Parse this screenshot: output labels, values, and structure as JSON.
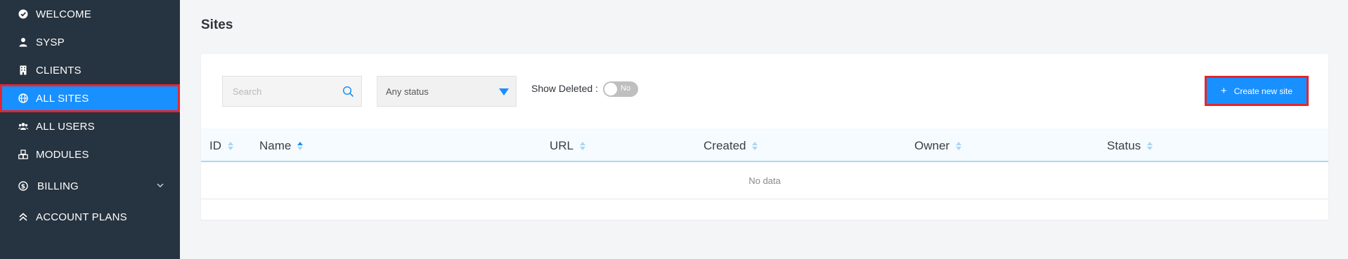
{
  "sidebar": {
    "items": [
      {
        "label": "WELCOME",
        "icon": "check-circle-icon"
      },
      {
        "label": "SYSP",
        "icon": "user-icon"
      },
      {
        "label": "CLIENTS",
        "icon": "building-icon"
      },
      {
        "label": "ALL SITES",
        "icon": "globe-icon",
        "active": true
      },
      {
        "label": "ALL USERS",
        "icon": "users-icon"
      },
      {
        "label": "MODULES",
        "icon": "cubes-icon"
      },
      {
        "label": "BILLING",
        "icon": "dollar-circle-icon",
        "expandable": true
      },
      {
        "label": "ACCOUNT PLANS",
        "icon": "double-chevron-up-icon"
      }
    ]
  },
  "page": {
    "title": "Sites"
  },
  "filters": {
    "search_placeholder": "Search",
    "status_value": "Any status",
    "show_deleted_label": "Show Deleted :",
    "show_deleted_value": "No"
  },
  "toolbar": {
    "create_label": "Create new site"
  },
  "table": {
    "columns": [
      "ID",
      "Name",
      "URL",
      "Created",
      "Owner",
      "Status"
    ],
    "empty_text": "No data"
  },
  "colors": {
    "sidebar_bg": "#263340",
    "accent": "#1890ff",
    "highlight_border": "#e3262e"
  }
}
